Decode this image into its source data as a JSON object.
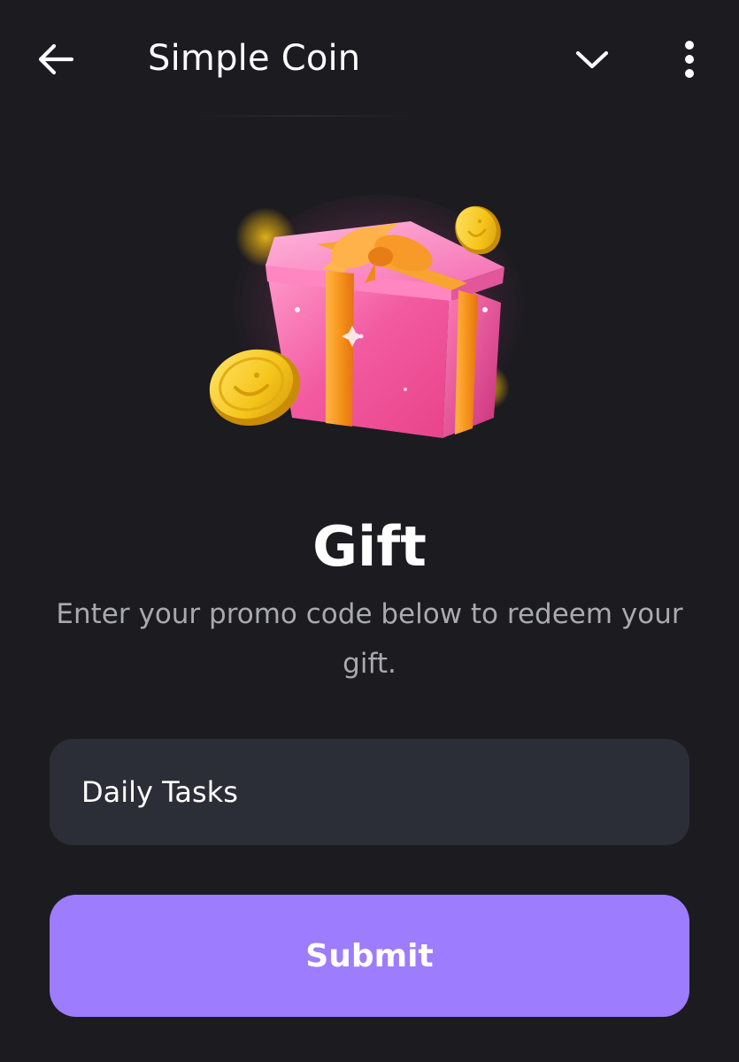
{
  "header": {
    "title": "Simple Coin",
    "back_icon": "arrow-left-icon",
    "dropdown_icon": "chevron-down-icon",
    "menu_icon": "more-vertical-icon"
  },
  "illustration": {
    "icon": "gift-box-with-coins-icon"
  },
  "main": {
    "title": "Gift",
    "subtitle": "Enter your promo code below to redeem your gift."
  },
  "promo": {
    "value": "Daily Tasks",
    "placeholder": ""
  },
  "actions": {
    "submit_label": "Submit"
  },
  "colors": {
    "background": "#1b1b20",
    "input_background": "#2b2e37",
    "accent": "#9d7cfd",
    "subtitle_text": "#a9a9b0",
    "coin_gold": "#f2c21b",
    "gift_pink": "#f06ea9",
    "ribbon_orange": "#f79a1e"
  }
}
